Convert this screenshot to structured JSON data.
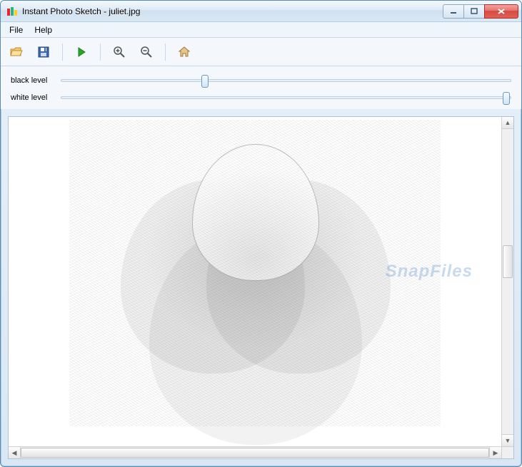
{
  "window": {
    "title": "Instant Photo Sketch - juliet.jpg"
  },
  "menu": {
    "file": "File",
    "help": "Help"
  },
  "toolbar": {
    "open": "open-icon",
    "save": "save-icon",
    "run": "play-icon",
    "zoom_in": "zoom-in-icon",
    "zoom_out": "zoom-out-icon",
    "home": "home-icon"
  },
  "sliders": {
    "black": {
      "label": "black level",
      "value_percent": 32
    },
    "white": {
      "label": "white level",
      "value_percent": 99
    }
  },
  "watermark": "SnapFiles"
}
